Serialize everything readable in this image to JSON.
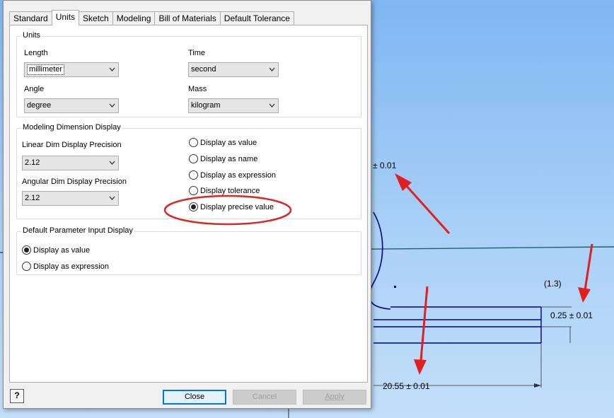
{
  "tabs": [
    {
      "label": "Standard",
      "active": false
    },
    {
      "label": "Units",
      "active": true
    },
    {
      "label": "Sketch",
      "active": false
    },
    {
      "label": "Modeling",
      "active": false
    },
    {
      "label": "Bill of Materials",
      "active": false
    },
    {
      "label": "Default Tolerance",
      "active": false
    }
  ],
  "units": {
    "title": "Units",
    "length_label": "Length",
    "length_value": "millimeter",
    "time_label": "Time",
    "time_value": "second",
    "angle_label": "Angle",
    "angle_value": "degree",
    "mass_label": "Mass",
    "mass_value": "kilogram"
  },
  "modeling": {
    "title": "Modeling Dimension Display",
    "linear_label": "Linear Dim Display Precision",
    "linear_value": "2.12",
    "angular_label": "Angular Dim Display Precision",
    "angular_value": "2.12",
    "options": [
      {
        "label": "Display as value",
        "selected": false
      },
      {
        "label": "Display as name",
        "selected": false
      },
      {
        "label": "Display as expression",
        "selected": false
      },
      {
        "label": "Display tolerance",
        "selected": false
      },
      {
        "label": "Display precise value",
        "selected": true
      }
    ]
  },
  "param_input": {
    "title": "Default Parameter Input Display",
    "options": [
      {
        "label": "Display as value",
        "selected": true
      },
      {
        "label": "Display as expression",
        "selected": false
      }
    ]
  },
  "buttons": {
    "help": "?",
    "close": "Close",
    "cancel": "Cancel",
    "apply": "Apply"
  },
  "cad": {
    "dim_top": "± 0.01",
    "dim_ref": "(1.3)",
    "dim_right": "0.25 ± 0.01",
    "dim_bottom": "20.55 ± 0.01"
  },
  "colors": {
    "sketch_line": "#00008b",
    "annotation": "#e02020",
    "accent": "#0078d7"
  }
}
